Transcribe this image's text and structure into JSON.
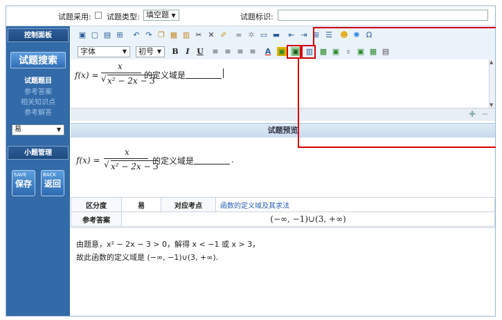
{
  "topbar": {
    "usage_label": "试题采用:",
    "type_label": "试题类型:",
    "type_value": "填空题",
    "tag_label": "试题标识:"
  },
  "sidebar": {
    "panel_title": "控制面板",
    "search_button": "试题搜索",
    "nav_items": [
      "试题题目",
      "参考答案",
      "相关知识点",
      "参考解答"
    ],
    "difficulty_value": "易",
    "sub_panel_title": "小题管理",
    "save_small": "SAVE",
    "save_label": "保存",
    "back_small": "BACK",
    "back_label": "返回"
  },
  "toolbar2": {
    "font_value": "字体",
    "size_value": "初号"
  },
  "editor": {
    "formula_lhs": "f(x) =",
    "numerator": "x",
    "radicand": "x² − 2x − 3",
    "suffix": "的定义域是"
  },
  "preview": {
    "header": "试题预览",
    "question_suffix": "的定义域是",
    "difficulty_label": "区分度",
    "difficulty_value": "易",
    "knowledge_label": "对应考点",
    "knowledge_value": "函数的定义域及其求法",
    "answer_label": "参考答案",
    "answer_value": "(−∞, −1)∪(3, +∞)",
    "solution_line1": "由题意，x² − 2x − 3 > 0，解得 x < −1 或 x > 3，",
    "solution_line2": "故此函数的定义域是 (−∞, −1)∪(3, +∞)."
  },
  "colors": {
    "sidebar": "#336aa8",
    "highlight": "#d40000",
    "link": "#2a5db0"
  }
}
